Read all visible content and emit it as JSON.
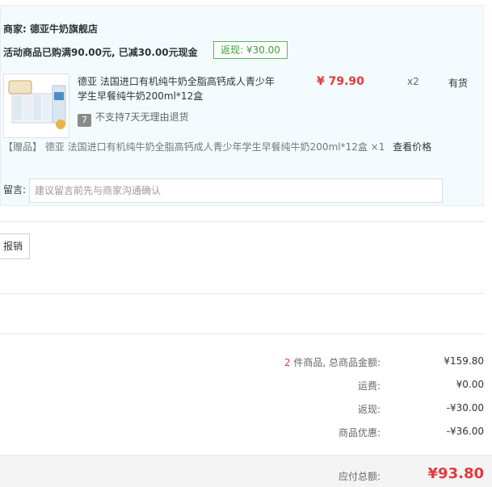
{
  "store": {
    "merchant_label": "商家: 德亚牛奶旗舰店",
    "promo_text": "活动商品已购满90.00元, 已减30.00元现金",
    "rebate_badge": "返现: ¥30.00"
  },
  "product": {
    "title": "德亚 法国进口有机纯牛奶全脂高钙成人青少年学生早餐纯牛奶200ml*12盒",
    "price": "¥ 79.90",
    "quantity": "x2",
    "stock": "有货",
    "return_icon": "7",
    "return_policy": "不支持7天无理由退货"
  },
  "gift": {
    "tag": "【赠品】",
    "text": "德亚 法国进口有机纯牛奶全脂高钙成人青少年学生早餐纯牛奶200ml*12盒 ×1",
    "check_price": "查看价格"
  },
  "note": {
    "label": "留言:",
    "placeholder": "建议留言前先与商家沟通确认"
  },
  "reimburse": {
    "label": "报销"
  },
  "summary": {
    "count": "2",
    "count_suffix": " 件商品, 总商品金额:",
    "subtotal": "¥159.80",
    "shipping_label": "运费:",
    "shipping": "¥0.00",
    "rebate_label": "返现:",
    "rebate": "-¥30.00",
    "discount_label": "商品优惠:",
    "discount": "-¥36.00"
  },
  "total": {
    "label": "应付总额:",
    "value": "¥93.80"
  },
  "colors": {
    "price_red": "#e4393c",
    "rebate_green": "#3aa03a",
    "store_bg": "#f3fbfe"
  }
}
